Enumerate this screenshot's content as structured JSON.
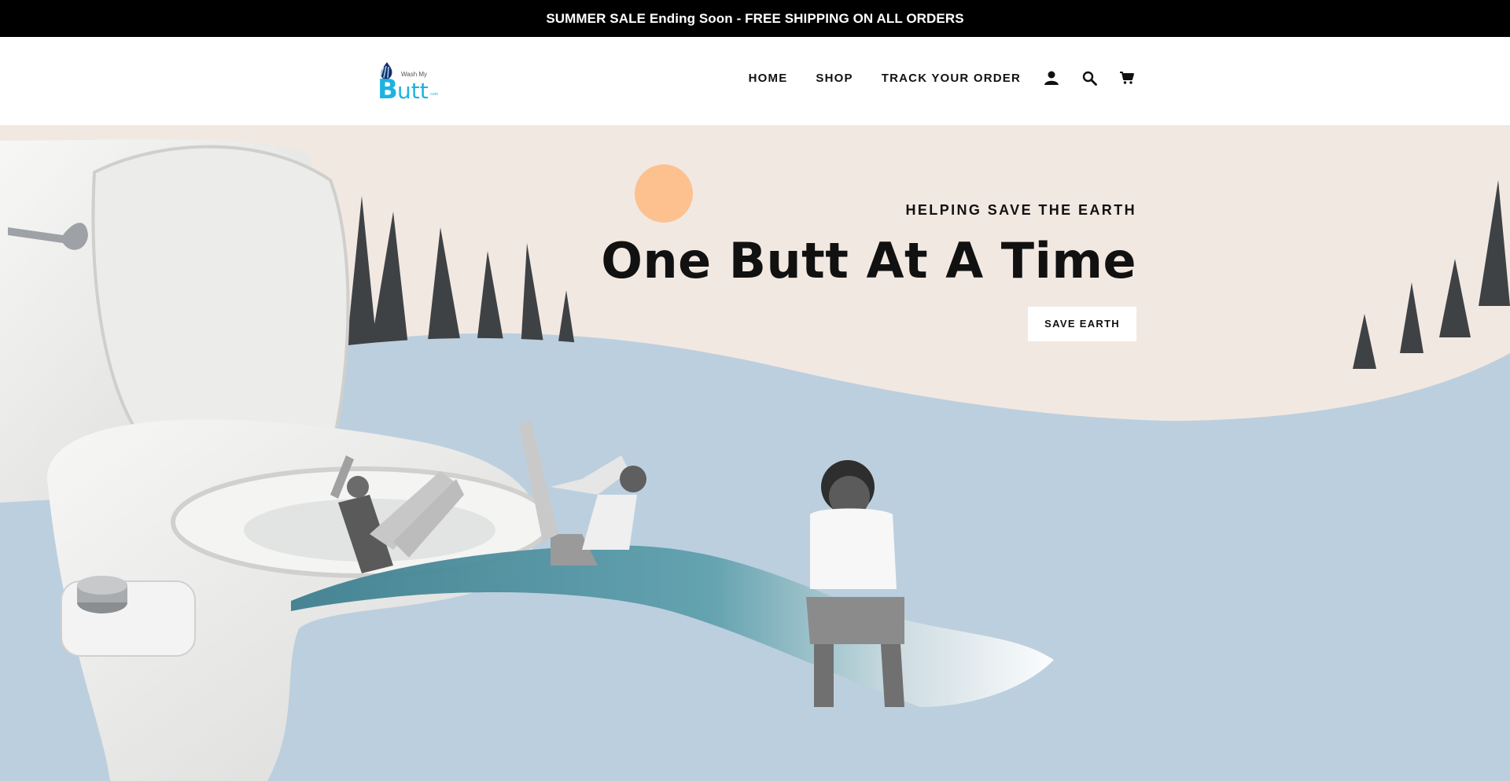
{
  "announcement": {
    "text": "SUMMER SALE Ending Soon - FREE SHIPPING ON ALL ORDERS"
  },
  "header": {
    "logo_text": "Wash My Butt .com",
    "nav": [
      {
        "label": "HOME"
      },
      {
        "label": "SHOP"
      },
      {
        "label": "TRACK YOUR ORDER"
      }
    ],
    "icons": [
      "account-icon",
      "search-icon",
      "cart-icon"
    ]
  },
  "hero": {
    "kicker": "HELPING SAVE THE EARTH",
    "title": "One Butt At A Time",
    "button_label": "SAVE EARTH"
  },
  "colors": {
    "announcement_bg": "#000000",
    "sky": "#f2e8e2",
    "ground": "#bccfde",
    "sun": "#fcc18f",
    "water": "#4a8a98",
    "logo_accent": "#1cb3e0"
  }
}
